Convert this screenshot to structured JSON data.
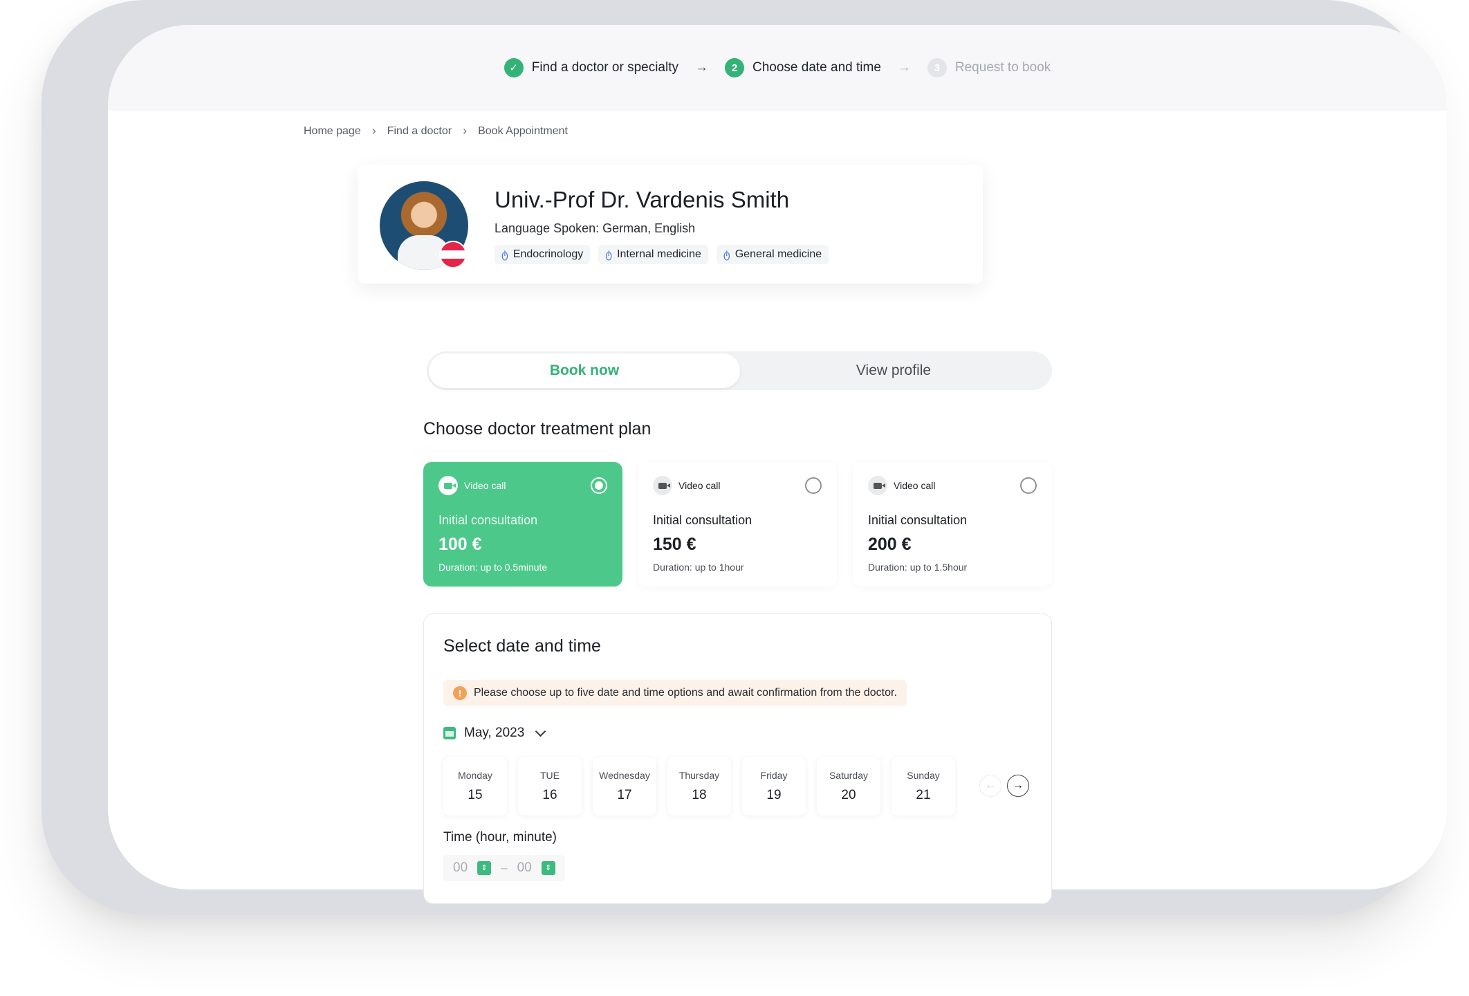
{
  "stepper": {
    "steps": [
      {
        "label": "Find a doctor or specialty",
        "state": "done",
        "marker": "✓"
      },
      {
        "label": "Choose date and time",
        "state": "active",
        "marker": "2"
      },
      {
        "label": "Request to book",
        "state": "pending",
        "marker": "3"
      }
    ]
  },
  "breadcrumb": [
    "Home page",
    "Find a doctor",
    "Book Appointment"
  ],
  "doctor": {
    "name": "Univ.-Prof Dr. Vardenis Smith",
    "languages": "Language Spoken: German, English",
    "specialties": [
      "Endocrinology",
      "Internal medicine",
      "General medicine"
    ]
  },
  "toggle": {
    "book_now": "Book now",
    "view_profile": "View profile"
  },
  "treatment": {
    "title": "Choose doctor treatment plan",
    "plans": [
      {
        "type": "Video call",
        "name": "Initial consultation",
        "price": "100 €",
        "duration": "Duration: up to 0.5minute",
        "selected": true
      },
      {
        "type": "Video call",
        "name": "Initial consultation",
        "price": "150 €",
        "duration": "Duration: up to 1hour",
        "selected": false
      },
      {
        "type": "Video call",
        "name": "Initial consultation",
        "price": "200 €",
        "duration": "Duration: up to 1.5hour",
        "selected": false
      }
    ]
  },
  "datetime": {
    "title": "Select date and time",
    "notice": "Please choose up to five date and time options and await confirmation from the doctor.",
    "notice_icon": "!",
    "month": "May, 2023",
    "days": [
      {
        "name": "Monday",
        "date": "15"
      },
      {
        "name": "TUE",
        "date": "16"
      },
      {
        "name": "Wednesday",
        "date": "17"
      },
      {
        "name": "Thursday",
        "date": "18"
      },
      {
        "name": "Friday",
        "date": "19"
      },
      {
        "name": "Saturday",
        "date": "20"
      },
      {
        "name": "Sunday",
        "date": "21"
      }
    ],
    "prev_icon": "←",
    "next_icon": "→",
    "time_label": "Time (hour, minute)",
    "hour": "00",
    "minute": "00",
    "separator": "–"
  },
  "colors": {
    "accent": "#34b277",
    "selected_plan": "#4cc98a",
    "notice_bg": "#fdf2ea"
  }
}
